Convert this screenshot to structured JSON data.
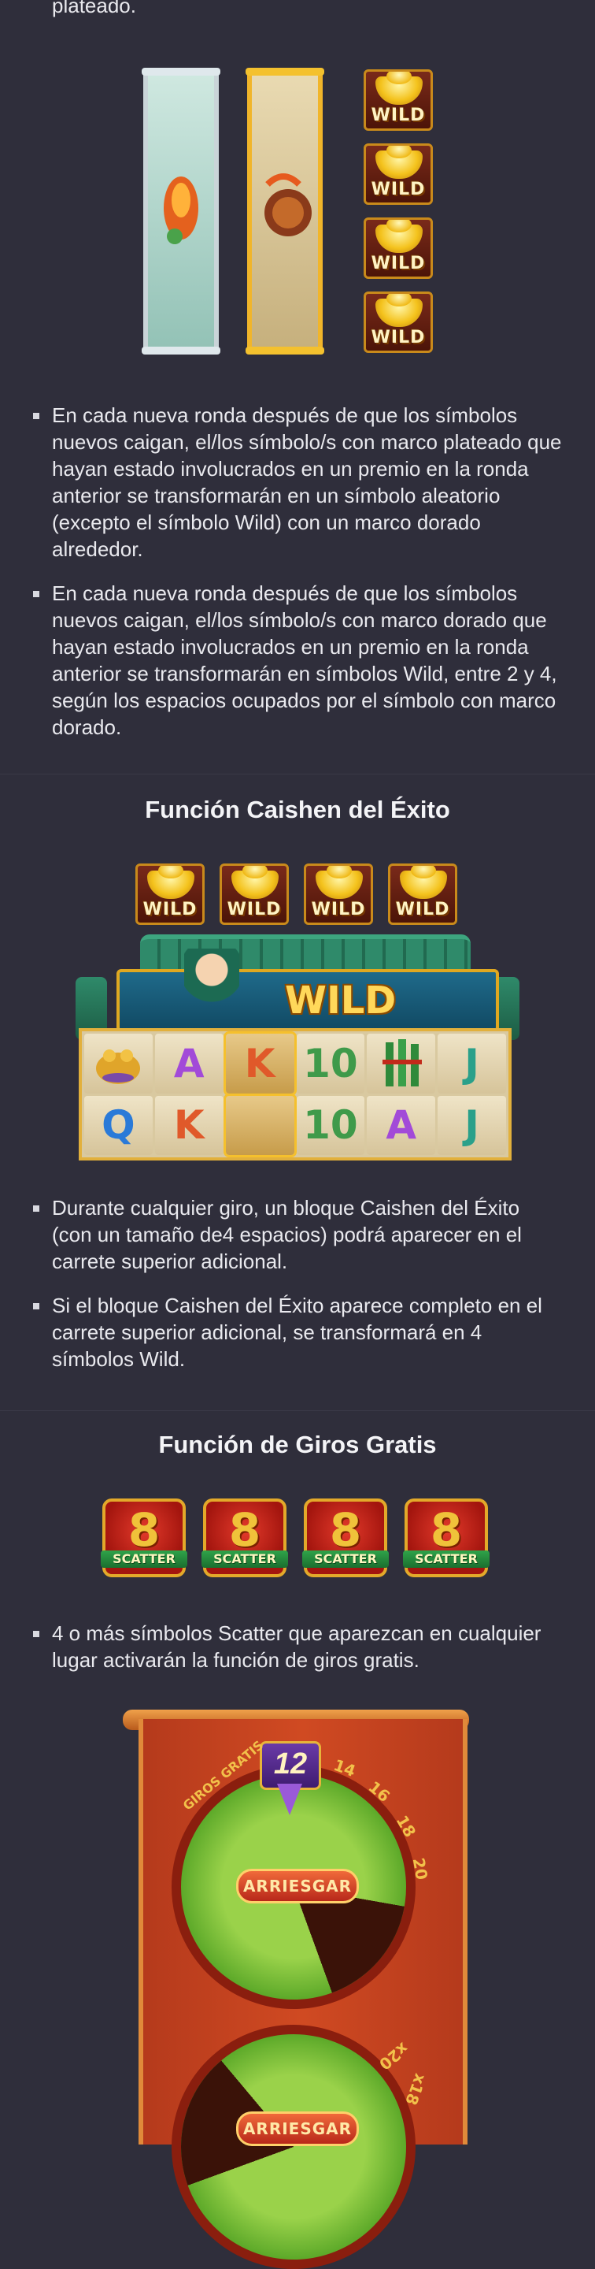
{
  "intro_tail": "plateado.",
  "wild_label": "WILD",
  "bullets_transform": [
    "En cada nueva ronda después de que los símbolos nuevos caigan, el/los símbolo/s con marco plateado que hayan estado involucrados en un premio en la ronda anterior se transformarán en un símbolo aleatorio (excepto el símbolo Wild) con un marco dorado alrededor.",
    "En cada nueva ronda después de que los símbolos nuevos caigan, el/los símbolo/s con marco dorado que hayan estado involucrados en un premio en la ronda anterior se transformarán en símbolos Wild, entre 2 y 4, según los espacios ocupados por el símbolo con marco dorado."
  ],
  "caishen": {
    "title": "Función Caishen del Éxito",
    "banner_label": "WILD",
    "grid_cells": [
      "",
      "A",
      "K",
      "10",
      "",
      "J",
      "Q",
      "K",
      "",
      "10",
      "A",
      "J"
    ],
    "bullets": [
      "Durante cualquier giro, un bloque Caishen del Éxito (con un tamaño de4 espacios) podrá aparecer en el carrete superior adicional.",
      "Si el bloque Caishen del Éxito aparece completo en el carrete superior adicional, se transformará en 4 símbolos Wild."
    ]
  },
  "free_spins": {
    "title": "Función de Giros Gratis",
    "scatter_label": "SCATTER",
    "scatter_digit": "8",
    "bullets": [
      "4 o más símbolos Scatter que aparezcan en cualquier lugar activarán la función de giros gratis."
    ],
    "wheel": {
      "badge_value": "12",
      "ring_label": "GIROS GRATIS",
      "ring_numbers": [
        "14",
        "16",
        "18",
        "20"
      ],
      "button_label": "ARRIESGAR",
      "lower_ring_labels": [
        "x20",
        "x18"
      ]
    }
  },
  "colors": {
    "background": "#2f2e3b",
    "text": "#e9e9ee",
    "gold": "#f1b52a",
    "silver": "#c9d4d8"
  }
}
